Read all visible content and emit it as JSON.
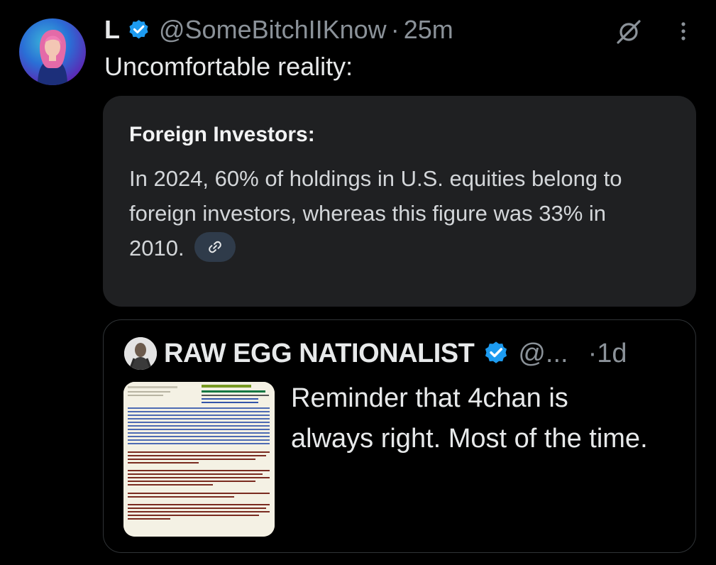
{
  "tweet": {
    "author_name": "L",
    "author_handle": "@SomeBitchIIKnow",
    "separator": "·",
    "time": "25m",
    "text": "Uncomfortable reality:",
    "avatar_icon": "user-avatar",
    "verified_icon": "verified-badge-icon",
    "action_icons": [
      "grok-icon",
      "more-options-icon"
    ]
  },
  "card": {
    "title": "Foreign Investors:",
    "body": "In 2024, 60% of holdings in U.S. equities belong to foreign investors, whereas this figure was 33% in 2010.",
    "link_icon": "link-icon"
  },
  "quote": {
    "author_name": "RAW EGG NATIONALIST",
    "author_handle": "@...",
    "separator": "·",
    "time": "1d",
    "text": "Reminder that 4chan is always right. Most of the time.",
    "image_icon": "screenshot-thumbnail"
  },
  "colors": {
    "background": "#000000",
    "card_background": "#1f2022",
    "verified_blue": "#1d9bf0",
    "muted_text": "#8b9299",
    "link_pill": "#2f3b4a"
  }
}
